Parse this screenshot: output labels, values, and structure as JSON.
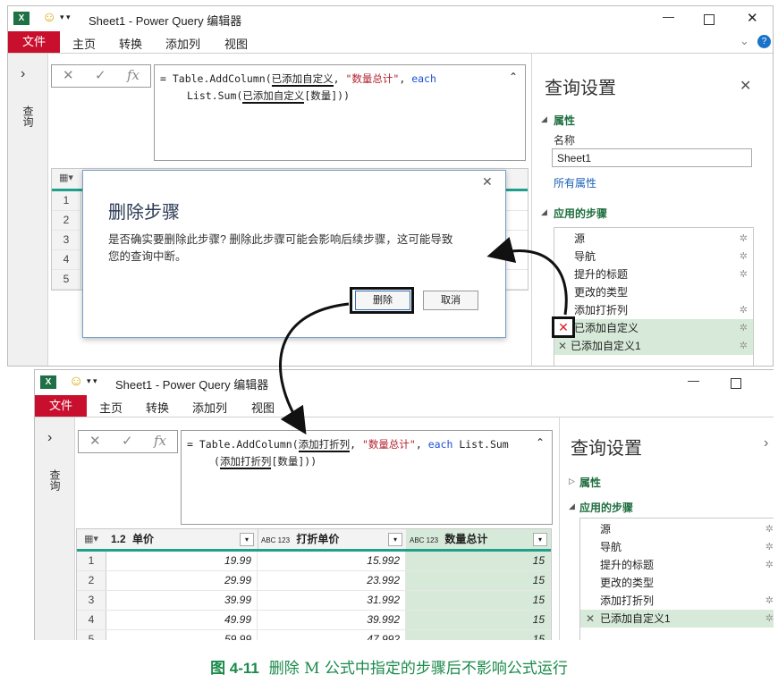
{
  "top": {
    "title": "Sheet1 - Power Query 编辑器",
    "ribbon": {
      "file": "文件",
      "tabs": [
        "主页",
        "转换",
        "添加列",
        "视图"
      ]
    },
    "nav_label": "查询",
    "formula": {
      "prefix": "= Table.AddColumn(",
      "ref1": "已添加自定义",
      "mid": ", ",
      "str": "\"数量总计\"",
      "comma": ", ",
      "kw": "each",
      "line2_prefix": "List.Sum(",
      "ref2": "已添加自定义",
      "line2_suffix": "[数量]))"
    },
    "grid_rows": [
      "1",
      "2",
      "3",
      "4",
      "5"
    ],
    "settings": {
      "title": "查询设置",
      "properties_label": "属性",
      "name_label": "名称",
      "name_value": "Sheet1",
      "all_properties": "所有属性",
      "steps_label": "应用的步骤",
      "steps": [
        "源",
        "导航",
        "提升的标题",
        "更改的类型",
        "添加打折列",
        "已添加自定义",
        "已添加自定义1"
      ]
    },
    "dialog": {
      "title": "删除步骤",
      "message_line1": "是否确实要删除此步骤? 删除此步骤可能会影响后续步骤，这可能导致",
      "message_line2": "您的查询中断。",
      "delete_label": "删除",
      "cancel_label": "取消"
    }
  },
  "bottom": {
    "title": "Sheet1 - Power Query 编辑器",
    "ribbon": {
      "file": "文件",
      "tabs": [
        "主页",
        "转换",
        "添加列",
        "视图"
      ]
    },
    "nav_label": "查询",
    "formula": {
      "prefix": "= Table.AddColumn(",
      "ref1": "添加打折列",
      "mid": ", ",
      "str": "\"数量总计\"",
      "comma": ", ",
      "kw": "each",
      "fn": " List.Sum",
      "line2_prefix": "(",
      "ref2": "添加打折列",
      "line2_suffix": "[数量]))"
    },
    "grid": {
      "columns": [
        {
          "type": "1.2",
          "name": "单价"
        },
        {
          "type": "ABC 123",
          "name": "打折单价"
        },
        {
          "type": "ABC 123",
          "name": "数量总计"
        }
      ],
      "rows": [
        {
          "n": "1",
          "v": [
            "19.99",
            "15.992",
            "15"
          ]
        },
        {
          "n": "2",
          "v": [
            "29.99",
            "23.992",
            "15"
          ]
        },
        {
          "n": "3",
          "v": [
            "39.99",
            "31.992",
            "15"
          ]
        },
        {
          "n": "4",
          "v": [
            "49.99",
            "39.992",
            "15"
          ]
        },
        {
          "n": "5",
          "v": [
            "59.99",
            "47.992",
            "15"
          ]
        }
      ]
    },
    "settings": {
      "title": "查询设置",
      "properties_label": "属性",
      "steps_label": "应用的步骤",
      "steps": [
        "源",
        "导航",
        "提升的标题",
        "更改的类型",
        "添加打折列",
        "已添加自定义1"
      ]
    }
  },
  "caption": {
    "label": "图 4-11",
    "text": "删除 M 公式中指定的步骤后不影响公式运行"
  },
  "colors": {
    "file_tab": "#c8102e",
    "accent_green": "#1e6e3e",
    "selected_step": "#d7ead9",
    "delete_x": "#d61f26"
  }
}
